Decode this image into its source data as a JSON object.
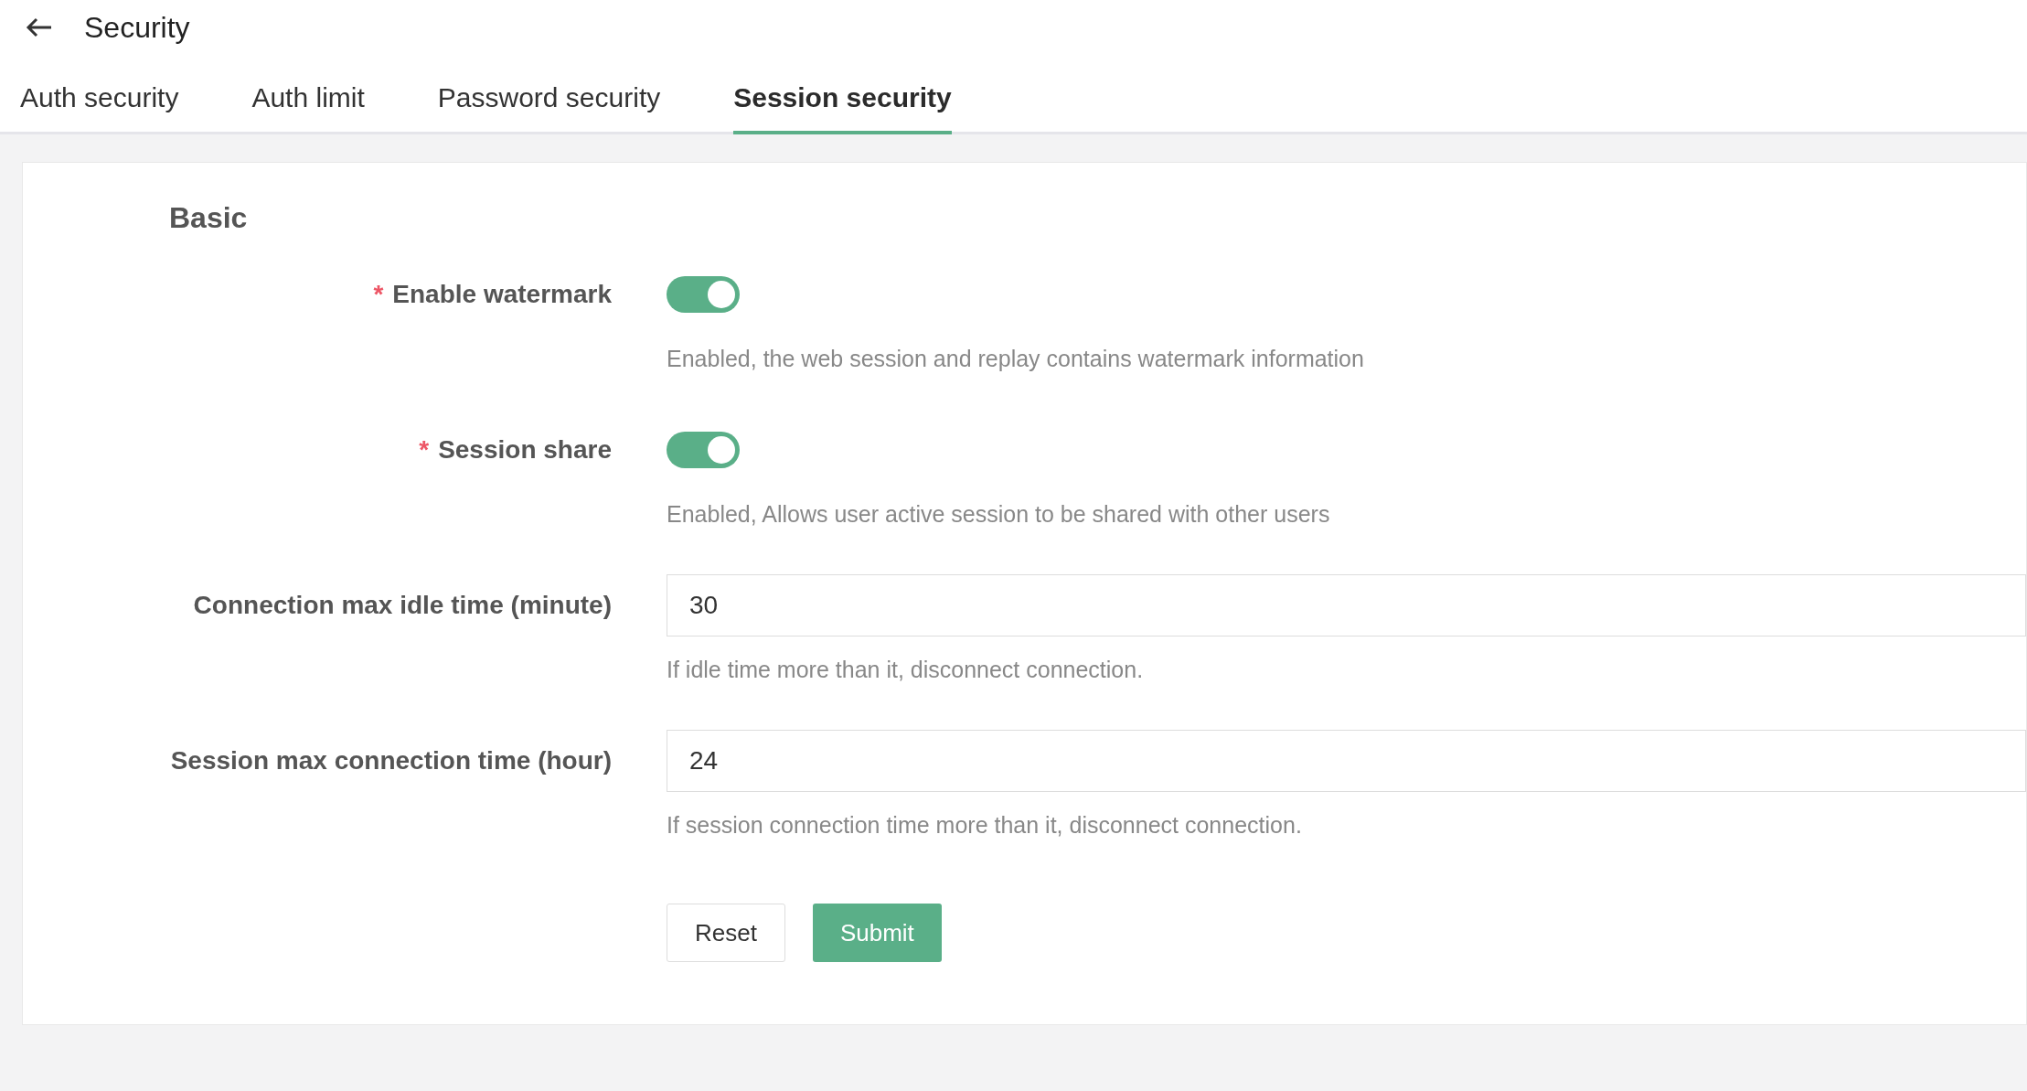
{
  "header": {
    "title": "Security"
  },
  "tabs": [
    {
      "label": "Auth security",
      "selected": false
    },
    {
      "label": "Auth limit",
      "selected": false
    },
    {
      "label": "Password security",
      "selected": false
    },
    {
      "label": "Session security",
      "selected": true
    }
  ],
  "section": {
    "title": "Basic"
  },
  "fields": [
    {
      "kind": "switch",
      "label": "Enable watermark",
      "required": true,
      "on": true,
      "help": "Enabled, the web session and replay contains watermark information"
    },
    {
      "kind": "switch",
      "label": "Session share",
      "required": true,
      "on": true,
      "help": "Enabled, Allows user active session to be shared with other users"
    },
    {
      "kind": "input",
      "label": "Connection max idle time (minute)",
      "required": false,
      "value": "30",
      "help": "If idle time more than it, disconnect connection."
    },
    {
      "kind": "input",
      "label": "Session max connection time (hour)",
      "required": false,
      "value": "24",
      "help": "If session connection time more than it, disconnect connection."
    }
  ],
  "buttons": {
    "reset": "Reset",
    "submit": "Submit"
  },
  "required_mark": "*"
}
